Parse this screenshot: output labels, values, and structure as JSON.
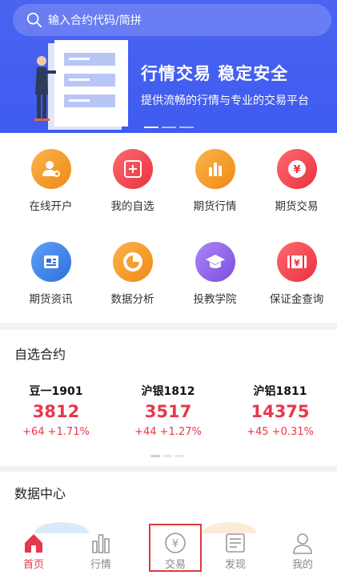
{
  "search": {
    "placeholder": "输入合约代码/简拼"
  },
  "banner": {
    "title": "行情交易  稳定安全",
    "subtitle": "提供流畅的行情与专业的交易平台"
  },
  "grid": [
    {
      "label": "在线开户",
      "icon": "user-key-icon",
      "color": "#f59a23"
    },
    {
      "label": "我的自选",
      "icon": "plus-square-icon",
      "color": "#f0424f"
    },
    {
      "label": "期货行情",
      "icon": "bar-chart-icon",
      "color": "#f59a23"
    },
    {
      "label": "期货交易",
      "icon": "yuan-coin-icon",
      "color": "#f0424f"
    },
    {
      "label": "期货资讯",
      "icon": "news-icon",
      "color": "#3f82e8"
    },
    {
      "label": "数据分析",
      "icon": "pie-chart-icon",
      "color": "#f59a23"
    },
    {
      "label": "投教学院",
      "icon": "graduation-cap-icon",
      "color": "#8f63e8"
    },
    {
      "label": "保证金查询",
      "icon": "yuan-ticket-icon",
      "color": "#f0424f"
    }
  ],
  "watchlist": {
    "title": "自选合约",
    "quotes": [
      {
        "name": "豆一1901",
        "price": "3812",
        "change": "+64  +1.71%"
      },
      {
        "name": "沪银1812",
        "price": "3517",
        "change": "+44  +1.27%"
      },
      {
        "name": "沪铝1811",
        "price": "14375",
        "change": "+45  +0.31%"
      }
    ]
  },
  "data_center": {
    "title": "数据中心"
  },
  "tabbar": [
    {
      "label": "首页",
      "icon": "home-icon",
      "active": true
    },
    {
      "label": "行情",
      "icon": "chart-bars-icon",
      "active": false
    },
    {
      "label": "交易",
      "icon": "yuan-circle-icon",
      "active": false
    },
    {
      "label": "发现",
      "icon": "newspaper-icon",
      "active": false
    },
    {
      "label": "我的",
      "icon": "person-icon",
      "active": false
    }
  ],
  "colors": {
    "brand_blue": "#4a63f0",
    "accent_red": "#e8374a"
  }
}
